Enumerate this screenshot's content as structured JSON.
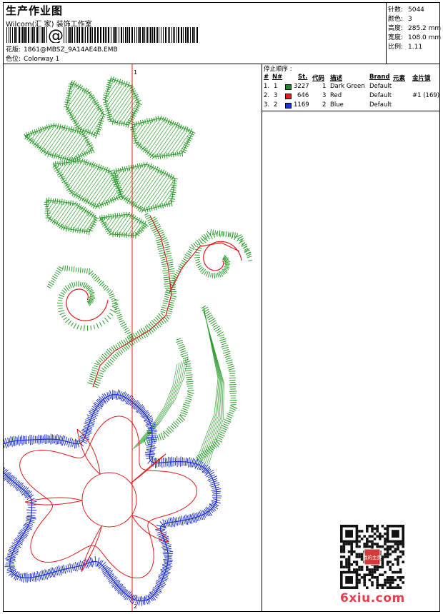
{
  "header": {
    "title": "生产作业图",
    "company": "Wilcom(汇 家) 装饰工作室",
    "barcode_char": "@",
    "design_label": "花版:",
    "design_file": "1861@MBSZ_9A14AE4B.EMB",
    "colorway_label": "色位:",
    "colorway": "Colorway 1"
  },
  "stats": [
    {
      "label": "针数:",
      "value": "5044"
    },
    {
      "label": "颜色:",
      "value": "3"
    },
    {
      "label": "高度:",
      "value": "285.2 mm"
    },
    {
      "label": "宽度:",
      "value": "108.0 mm"
    },
    {
      "label": "比例:",
      "value": "1.11"
    }
  ],
  "stop_sequence": {
    "title": "停止顺序 :",
    "columns": [
      "#",
      "N#",
      "St.",
      "代码",
      "描述",
      "Brand",
      "元素",
      "金片锁"
    ],
    "rows": [
      {
        "idx": "1.",
        "needle": "1",
        "color": "#1e8a2e",
        "stitches": "3227",
        "code": "1",
        "desc": "Dark Green",
        "brand": "Default",
        "element": "",
        "sequin": ""
      },
      {
        "idx": "2.",
        "needle": "3",
        "color": "#e8191c",
        "stitches": "646",
        "code": "3",
        "desc": "Red",
        "brand": "Default",
        "element": "",
        "sequin": "#1 (169)"
      },
      {
        "idx": "3.",
        "needle": "2",
        "color": "#1d35d6",
        "stitches": "1169",
        "code": "2",
        "desc": "Blue",
        "brand": "Default",
        "element": "",
        "sequin": ""
      }
    ]
  },
  "design": {
    "marker_top": "1",
    "marker_bottom": "2",
    "thread_colors": {
      "green": "#2a9a2a",
      "red": "#e01818",
      "blue": "#1d2fd0"
    }
  },
  "watermark": {
    "text": "6xiu.com",
    "qr_badge": "我的主页"
  }
}
